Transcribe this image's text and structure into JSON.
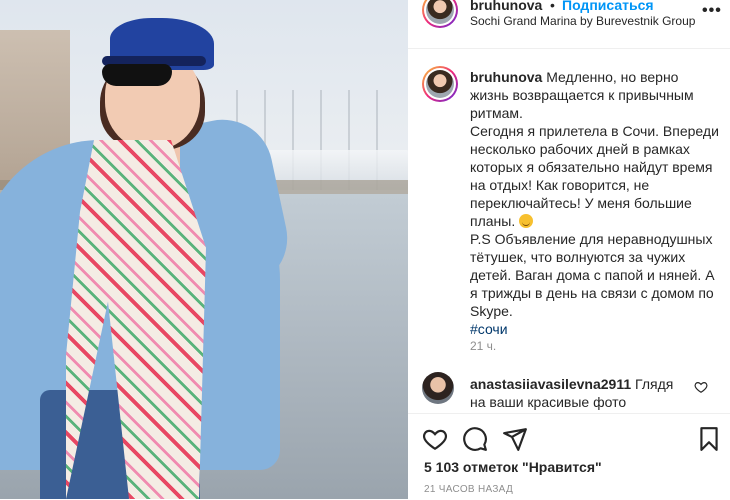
{
  "header": {
    "username": "bruhunova",
    "dot": "•",
    "follow_label": "Подписаться",
    "location": "Sochi Grand Marina by Burevestnik Group",
    "more_icon": "more-icon"
  },
  "caption": {
    "username": "bruhunova",
    "line_1": "Медленно, но верно жизнь возвращается к привычным ритмам.",
    "line_2": "Сегодня я прилетела в Сочи. Впереди несколько рабочих дней в рамках которых я обязательно найдут время на отдых! Как говорится, не переключайтесь! У меня большие планы.",
    "line_3": "P.S Объявление для неравнодушных тётушек, что волнуются за чужих детей. Ваган дома с папой и няней. А я трижды в день на связи с домом по Skype.",
    "hashtag": "#сочи",
    "time": "21 ч."
  },
  "comment": {
    "username": "anastasiiavasilevna2911",
    "text": "Глядя на ваши красивые фото"
  },
  "actions": {
    "likes": "5 103 отметок \"Нравится\"",
    "date": "21 ЧАСОВ НАЗАД"
  },
  "colors": {
    "link_blue": "#0095f6",
    "hashtag": "#00376b",
    "muted": "#8e8e8e",
    "text": "#262626"
  }
}
